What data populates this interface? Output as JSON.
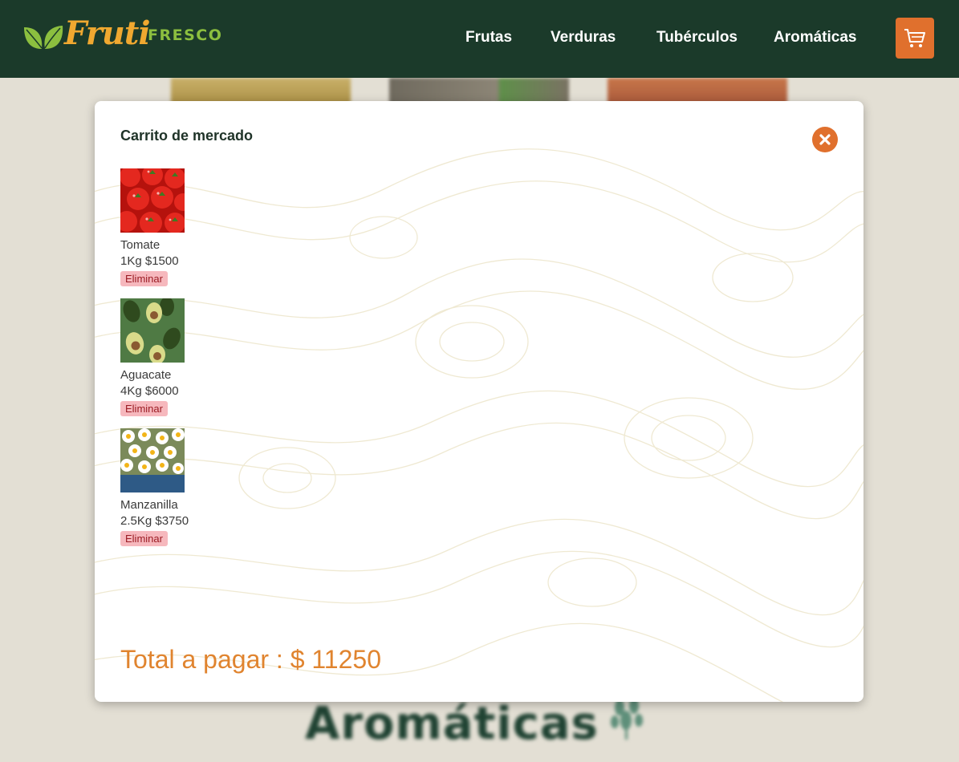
{
  "brand": {
    "script_name": "Fruti",
    "word": "FRESCO"
  },
  "nav": {
    "items": [
      "Frutas",
      "Verduras",
      "Tubérculos",
      "Aromáticas"
    ]
  },
  "icons": {
    "cart": "shopping-cart-icon",
    "close": "close-icon",
    "logo": "leaf-icon"
  },
  "colors": {
    "header": "#1b3a2a",
    "accent": "#e0702d",
    "logo_script": "#f0a830",
    "logo_word": "#8cbf3f",
    "remove_bg": "#f6b8bd"
  },
  "background": {
    "section_heading": "Aromáticas"
  },
  "cart": {
    "title": "Carrito de mercado",
    "remove_label": "Eliminar",
    "items": [
      {
        "name": "Tomate",
        "qty": "1Kg $1500",
        "image": "tomatoes"
      },
      {
        "name": "Aguacate",
        "qty": "4Kg $6000",
        "image": "avocados"
      },
      {
        "name": "Manzanilla",
        "qty": "2.5Kg $3750",
        "image": "chamomile"
      }
    ],
    "total": "Total a pagar : $ 11250"
  }
}
